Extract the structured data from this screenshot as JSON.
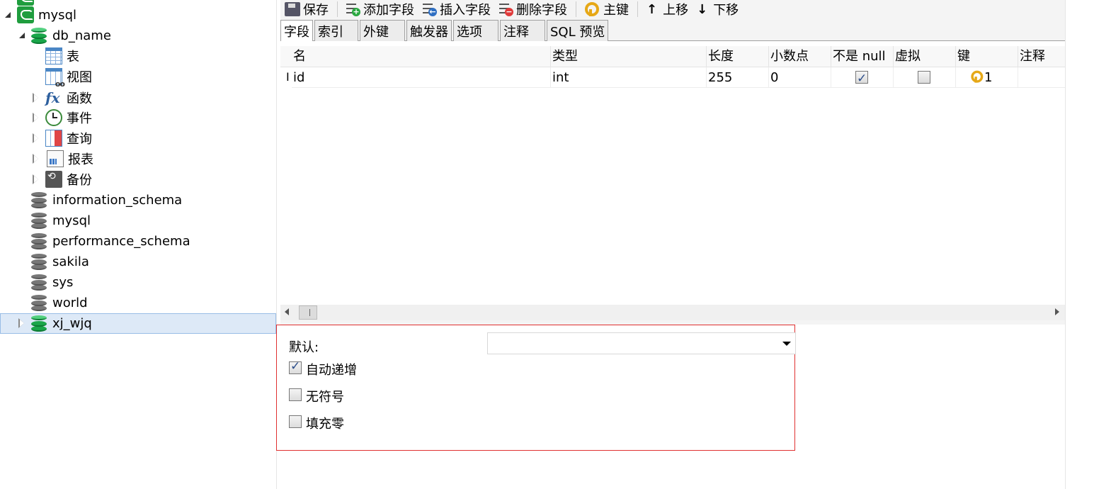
{
  "tree": {
    "connection": "mysql",
    "database_open": "db_name",
    "db_children": [
      "表",
      "视图",
      "函数",
      "事件",
      "查询",
      "报表",
      "备份"
    ],
    "databases": [
      "information_schema",
      "mysql",
      "performance_schema",
      "sakila",
      "sys",
      "world",
      "xj_wjq"
    ]
  },
  "toolbar": {
    "save": "保存",
    "add_field": "添加字段",
    "insert_field": "插入字段",
    "delete_field": "删除字段",
    "primary_key": "主键",
    "move_up": "上移",
    "move_down": "下移"
  },
  "tabs": [
    "字段",
    "索引",
    "外键",
    "触发器",
    "选项",
    "注释",
    "SQL 预览"
  ],
  "grid": {
    "headers": [
      "名",
      "类型",
      "长度",
      "小数点",
      "不是 null",
      "虚拟",
      "键",
      "注释"
    ],
    "row_marker": "I",
    "rows": [
      {
        "name": "id",
        "type": "int",
        "length": "255",
        "decimals": "0",
        "not_null": true,
        "virtual": false,
        "key": "1",
        "comment": ""
      }
    ]
  },
  "props": {
    "default_label": "默认:",
    "default_value": "",
    "auto_increment": "自动递增",
    "auto_increment_checked": true,
    "unsigned": "无符号",
    "unsigned_checked": false,
    "zerofill": "填充零",
    "zerofill_checked": false
  },
  "colors": {
    "highlight_border": "#e03030",
    "selection": "#dde9f7",
    "db_green": "#1aa64a",
    "key_gold": "#e6a817"
  }
}
